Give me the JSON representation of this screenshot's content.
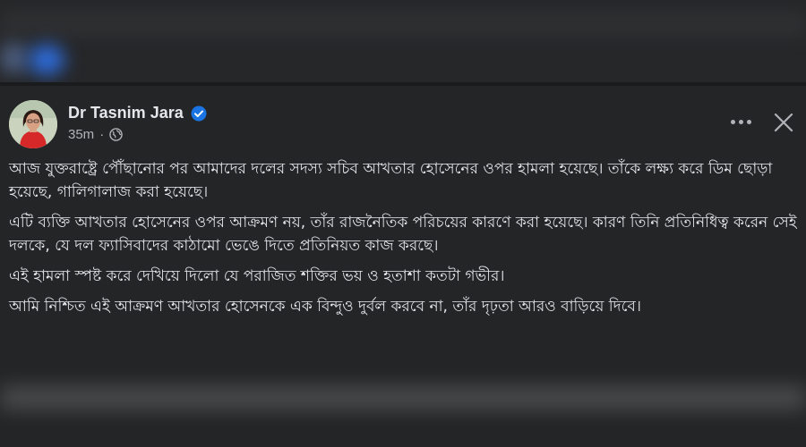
{
  "post": {
    "author": "Dr Tasnim Jara",
    "time": "35m",
    "paragraphs": [
      "আজ যুক্তরাষ্ট্রে পৌঁছানোর পর আমাদের দলের সদস্য সচিব আখতার হোসেনের ওপর হামলা হয়েছে। তাঁকে লক্ষ্য করে ডিম ছোড়া হয়েছে, গালিগালাজ করা হয়েছে।",
      "এটি ব্যক্তি আখতার হোসেনের ওপর আক্রমণ নয়, তাঁর রাজনৈতিক পরিচয়ের কারণে করা হয়েছে। কারণ তিনি প্রতিনিধিত্ব করেন সেই দলকে, যে দল ফ্যাসিবাদের কাঠামো ভেঙে দিতে প্রতিনিয়ত কাজ করছে।",
      "এই হামলা স্পষ্ট করে দেখিয়ে দিলো যে পরাজিত শক্তির ভয় ও হতাশা কতটা গভীর।",
      "আমি নিশ্চিত এই আক্রমণ আখতার হোসেনকে এক বিন্দুও দুর্বল করবে না,  তাঁর দৃঢ়তা আরও বাড়িয়ে দিবে।"
    ]
  },
  "icons": {
    "verified": "verified-badge-icon",
    "audience": "globe-icon",
    "more": "more-options-icon",
    "close": "close-icon"
  },
  "colors": {
    "background": "#242526",
    "text": "#e4e6eb",
    "secondary_text": "#b0b3b8",
    "verified_blue": "#1b74e4"
  }
}
